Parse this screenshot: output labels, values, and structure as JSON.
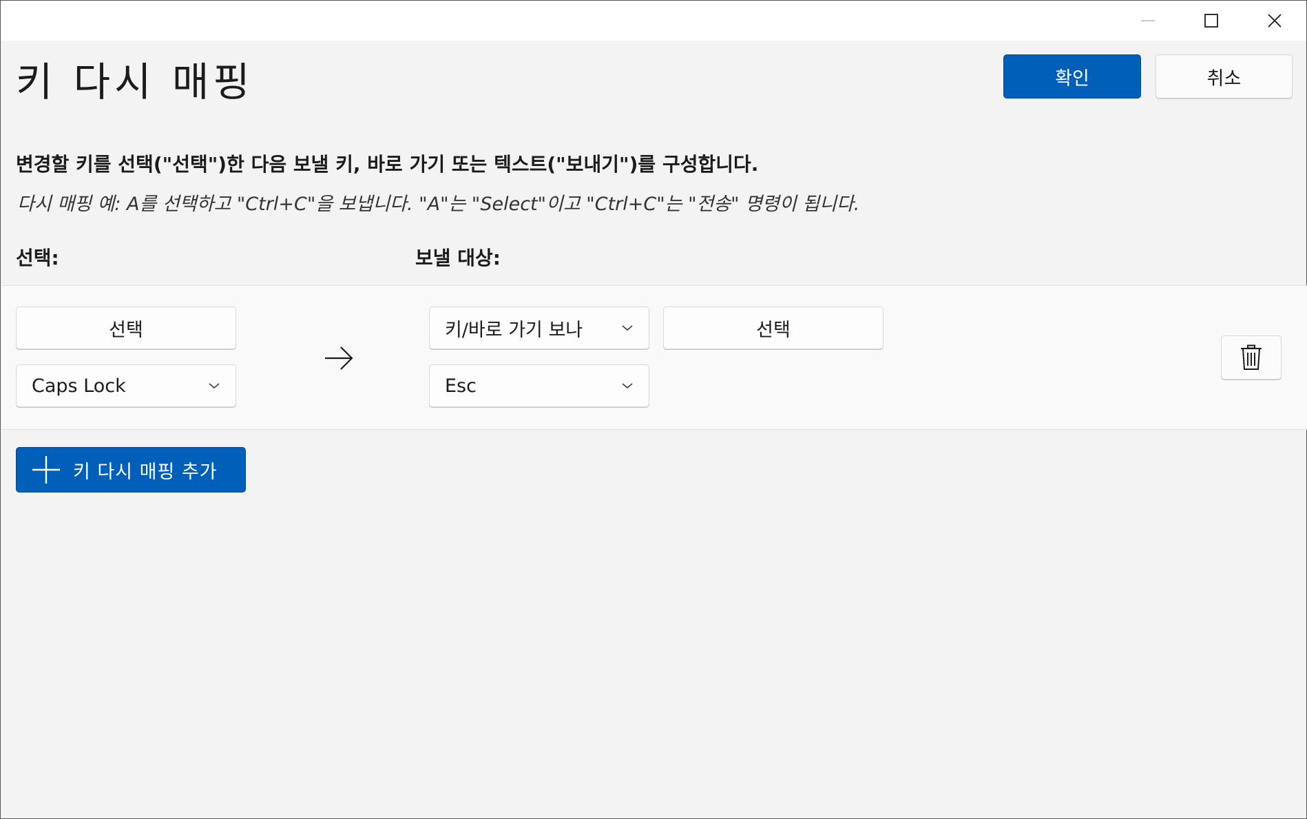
{
  "window": {
    "controls": {
      "minimize_icon": "minimize-icon",
      "maximize_icon": "maximize-icon",
      "close_icon": "close-icon"
    }
  },
  "header": {
    "title": "키 다시 매핑",
    "ok_label": "확인",
    "cancel_label": "취소"
  },
  "description": {
    "instruction": "변경할 키를 선택(\"선택\")한 다음 보낼 키, 바로 가기 또는 텍스트(\"보내기\")를 구성합니다.",
    "example": "다시 매핑 예: A를 선택하고 \"Ctrl+C\"을 보냅니다. \"A\"는 \"Select\"이고 \"Ctrl+C\"는 \"전송\" 명령이 됩니다."
  },
  "columns": {
    "select_label": "선택:",
    "target_label": "보낼 대상:"
  },
  "mapping": {
    "select_button_label": "선택",
    "original_key": "Caps Lock",
    "target_type": "키/바로 가기 보나",
    "target_select_button_label": "선택",
    "target_key": "Esc",
    "arrow_icon": "arrow-right-icon",
    "delete_icon": "trash-icon"
  },
  "add_button": {
    "label": "키 다시 매핑 추가",
    "icon": "plus-icon"
  },
  "colors": {
    "accent": "#005fb8",
    "background": "#f3f3f3",
    "panel": "#f9f9f9"
  }
}
